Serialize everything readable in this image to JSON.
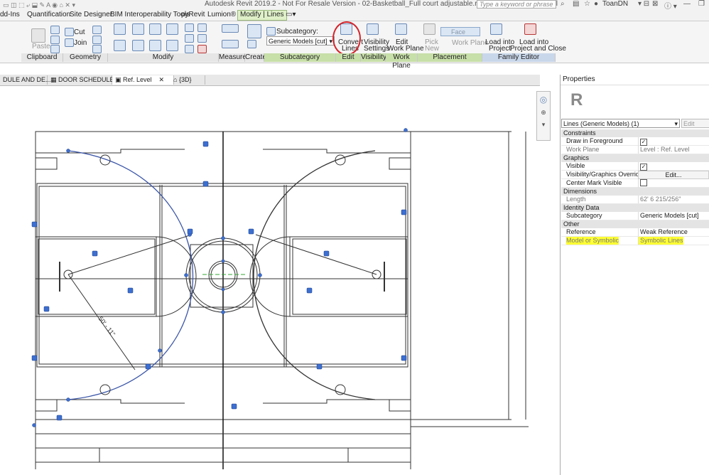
{
  "window": {
    "title": "Autodesk Revit 2019.2 - Not For Resale Version - 02-Basketball_Full court adjustable.rfa - Floor Plan: Ref. Level",
    "search_placeholder": "Type a keyword or phrase",
    "user": "ToanDN"
  },
  "ribbon_tabs": [
    "dd-Ins",
    "Quantification",
    "Site Designer",
    "BIM Interoperability Tools",
    "pyRevit",
    "Lumion®",
    "Modify | Lines"
  ],
  "ribbon": {
    "paste": "Paste",
    "cut": "Cut",
    "join": "Join",
    "subcategory_label": "Subcategory:",
    "subcategory_value": "Generic Models [cut]",
    "convert_lines_1": "Convert",
    "convert_lines_2": "Lines",
    "visibility_1": "Visibility",
    "visibility_2": "Settings",
    "edit_work_plane_1": "Edit",
    "edit_work_plane_2": "Work Plane",
    "pick_new_1": "Pick",
    "pick_new_2": "New",
    "face": "Face",
    "work_plane": "Work Plane",
    "load_into_project_1": "Load into",
    "load_into_project_2": "Project",
    "load_close_1": "Load into",
    "load_close_2": "Project and Close",
    "panels": {
      "clipboard": "Clipboard",
      "geometry": "Geometry",
      "modify": "Modify",
      "measure": "Measure",
      "create": "Create",
      "subcategory": "Subcategory",
      "edit": "Edit",
      "visibility": "Visibility",
      "work_plane": "Work Plane",
      "placement": "Placement",
      "family_editor": "Family Editor"
    }
  },
  "doc_tabs": [
    "DULE AND DE...",
    "DOOR SCHEDULE",
    "Ref. Level",
    "{3D}"
  ],
  "canvas": {
    "dimension_label": "50' - 11\""
  },
  "properties": {
    "title": "Properties",
    "type_selector": "Lines (Generic Models) (1)",
    "edit_type": "Edit Type",
    "groups": {
      "constraints": "Constraints",
      "graphics": "Graphics",
      "dimensions": "Dimensions",
      "identity": "Identity Data",
      "other": "Other"
    },
    "rows": {
      "draw_in_foreground": "Draw in Foreground",
      "work_plane_k": "Work Plane",
      "work_plane_v": "Level : Ref. Level",
      "visible": "Visible",
      "vg_overrides": "Visibility/Graphics Overrides",
      "edit_button": "Edit...",
      "center_mark": "Center Mark Visible",
      "length_k": "Length",
      "length_v": "62'  6 215/256\"",
      "subcategory_k": "Subcategory",
      "subcategory_v": "Generic Models [cut]",
      "reference_k": "Reference",
      "reference_v": "Weak Reference",
      "model_or_symbolic_k": "Model or Symbolic",
      "model_or_symbolic_v": "Symbolic Lines"
    },
    "draw_in_foreground_checked": true,
    "visible_checked": true,
    "center_mark_checked": false
  },
  "colors": {
    "ribbon_active_tab": "#dff0c8",
    "highlight": "#ffff33",
    "annotation_circle": "#d4242b",
    "selected_arc": "#3a55a8"
  }
}
